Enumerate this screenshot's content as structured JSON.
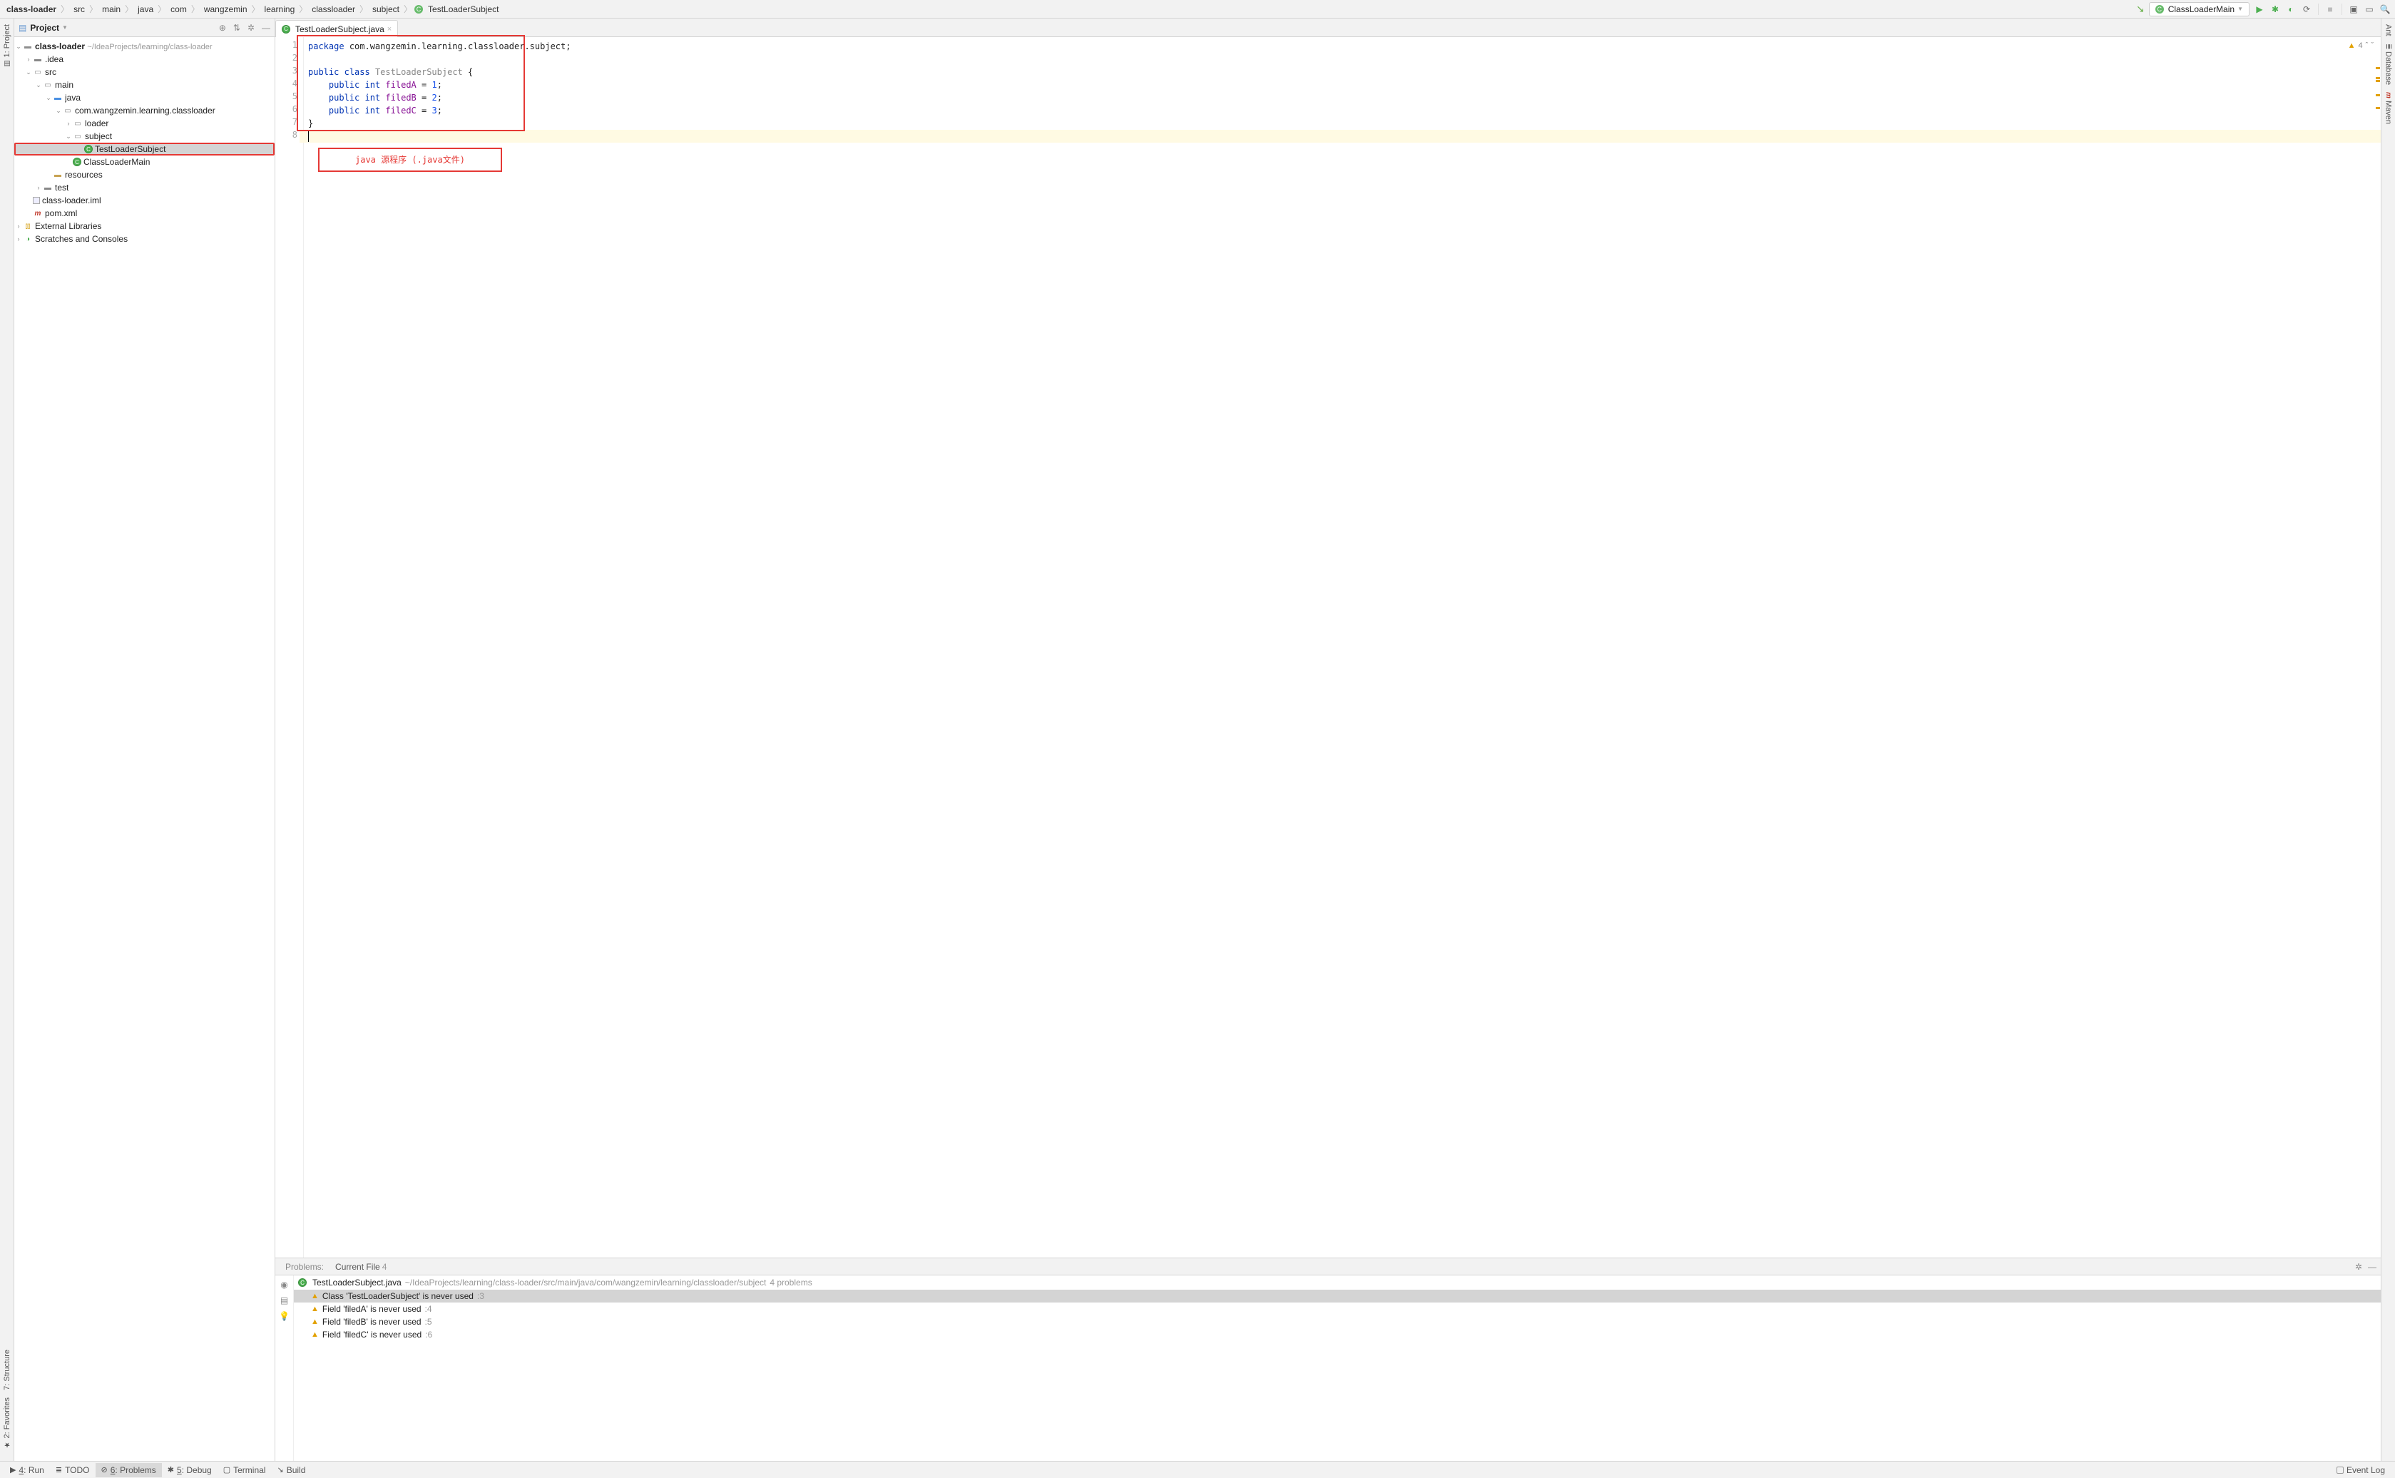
{
  "breadcrumbs": [
    "class-loader",
    "src",
    "main",
    "java",
    "com",
    "wangzemin",
    "learning",
    "classloader",
    "subject",
    "TestLoaderSubject"
  ],
  "runConfig": {
    "name": "ClassLoaderMain"
  },
  "projectPanel": {
    "title": "Project"
  },
  "tree": {
    "root_name": "class-loader",
    "root_path": "~/IdeaProjects/learning/class-loader",
    "idea": ".idea",
    "src": "src",
    "main": "main",
    "java": "java",
    "pkg": "com.wangzemin.learning.classloader",
    "loader": "loader",
    "subject": "subject",
    "tls": "TestLoaderSubject",
    "clm": "ClassLoaderMain",
    "resources": "resources",
    "test": "test",
    "iml": "class-loader.iml",
    "pom": "pom.xml",
    "ext": "External Libraries",
    "scratches": "Scratches and Consoles"
  },
  "editor": {
    "tab": "TestLoaderSubject.java",
    "warnings": "4",
    "annotation_label": "java 源程序 (.java文件)",
    "lines": {
      "l1_pkg": "package",
      "l1_pkgv": "com.wangzemin.learning.classloader.subject",
      "l3_pub": "public",
      "l3_cls": "class",
      "l3_name": "TestLoaderSubject",
      "l3_b": "{",
      "l4_pub": "public",
      "l4_int": "int",
      "l4_f": "filedA",
      "l4_eq": " = ",
      "l4_v": "1",
      "l5_pub": "public",
      "l5_int": "int",
      "l5_f": "filedB",
      "l5_eq": " = ",
      "l5_v": "2",
      "l6_pub": "public",
      "l6_int": "int",
      "l6_f": "filedC",
      "l6_eq": " = ",
      "l6_v": "3",
      "l7": "}"
    }
  },
  "problems": {
    "tab_problems": "Problems:",
    "tab_current": "Current File",
    "tab_current_count": "4",
    "header_file": "TestLoaderSubject.java",
    "header_path": "~/IdeaProjects/learning/class-loader/src/main/java/com/wangzemin/learning/classloader/subject",
    "header_count": "4 problems",
    "rows": [
      {
        "msg": "Class 'TestLoaderSubject' is never used",
        "ln": ":3"
      },
      {
        "msg": "Field 'filedA' is never used",
        "ln": ":4"
      },
      {
        "msg": "Field 'filedB' is never used",
        "ln": ":5"
      },
      {
        "msg": "Field 'filedC' is never used",
        "ln": ":6"
      }
    ]
  },
  "bottom": {
    "run": "4: Run",
    "todo": "TODO",
    "problems": "6: Problems",
    "debug": "5: Debug",
    "terminal": "Terminal",
    "build": "Build",
    "eventlog": "Event Log"
  },
  "left_labels": {
    "project": "1: Project",
    "structure": "7: Structure",
    "favorites": "2: Favorites"
  },
  "right_labels": {
    "ant": "Ant",
    "database": "Database",
    "maven": "Maven"
  }
}
